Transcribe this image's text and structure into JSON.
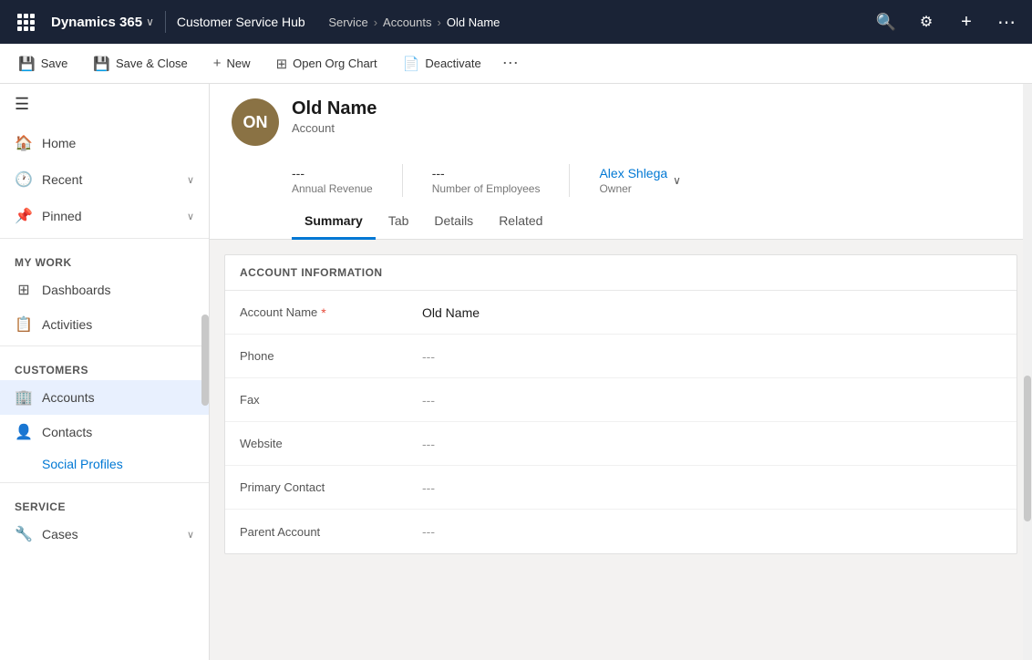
{
  "app": {
    "waffle": "⊞",
    "name": "Dynamics 365",
    "chevron": "∨",
    "hub": "Customer Service Hub"
  },
  "breadcrumb": {
    "items": [
      {
        "label": "Service",
        "isCurrent": false
      },
      {
        "label": "Accounts",
        "isCurrent": false
      },
      {
        "label": "Old Name",
        "isCurrent": true
      }
    ]
  },
  "topnav_icons": {
    "search": "🔍",
    "target": "⊙",
    "plus": "+",
    "more": "⋯"
  },
  "toolbar": {
    "save_label": "Save",
    "save_close_label": "Save & Close",
    "new_label": "New",
    "org_chart_label": "Open Org Chart",
    "deactivate_label": "Deactivate"
  },
  "sidebar": {
    "hamburger": "☰",
    "nav_items": [
      {
        "icon": "🏠",
        "label": "Home",
        "hasChevron": false
      },
      {
        "icon": "🕐",
        "label": "Recent",
        "hasChevron": true
      },
      {
        "icon": "📌",
        "label": "Pinned",
        "hasChevron": true
      }
    ],
    "sections": [
      {
        "label": "My Work",
        "items": [
          {
            "icon": "⊞",
            "label": "Dashboards",
            "active": false
          },
          {
            "icon": "📋",
            "label": "Activities",
            "active": false
          }
        ]
      },
      {
        "label": "Customers",
        "items": [
          {
            "icon": "🏢",
            "label": "Accounts",
            "active": true
          },
          {
            "icon": "👤",
            "label": "Contacts",
            "active": false
          }
        ],
        "subitems": [
          {
            "label": "Social Profiles",
            "isSocial": false
          }
        ]
      },
      {
        "label": "Service",
        "items": [
          {
            "icon": "🔧",
            "label": "Cases",
            "active": false
          }
        ]
      }
    ]
  },
  "record": {
    "initials": "ON",
    "name": "Old Name",
    "type": "Account",
    "annual_revenue": "---",
    "annual_revenue_label": "Annual Revenue",
    "num_employees": "---",
    "num_employees_label": "Number of Employees",
    "owner": "Alex Shlega",
    "owner_label": "Owner"
  },
  "tabs": [
    {
      "label": "Summary",
      "active": true
    },
    {
      "label": "Tab",
      "active": false
    },
    {
      "label": "Details",
      "active": false
    },
    {
      "label": "Related",
      "active": false
    }
  ],
  "account_info": {
    "section_title": "ACCOUNT INFORMATION",
    "fields": [
      {
        "label": "Account Name",
        "required": true,
        "value": "Old Name",
        "isEmpty": false
      },
      {
        "label": "Phone",
        "required": false,
        "value": "---",
        "isEmpty": true
      },
      {
        "label": "Fax",
        "required": false,
        "value": "---",
        "isEmpty": true
      },
      {
        "label": "Website",
        "required": false,
        "value": "---",
        "isEmpty": true
      },
      {
        "label": "Primary Contact",
        "required": false,
        "value": "---",
        "isEmpty": true
      },
      {
        "label": "Parent Account",
        "required": false,
        "value": "---",
        "isEmpty": true
      }
    ]
  }
}
